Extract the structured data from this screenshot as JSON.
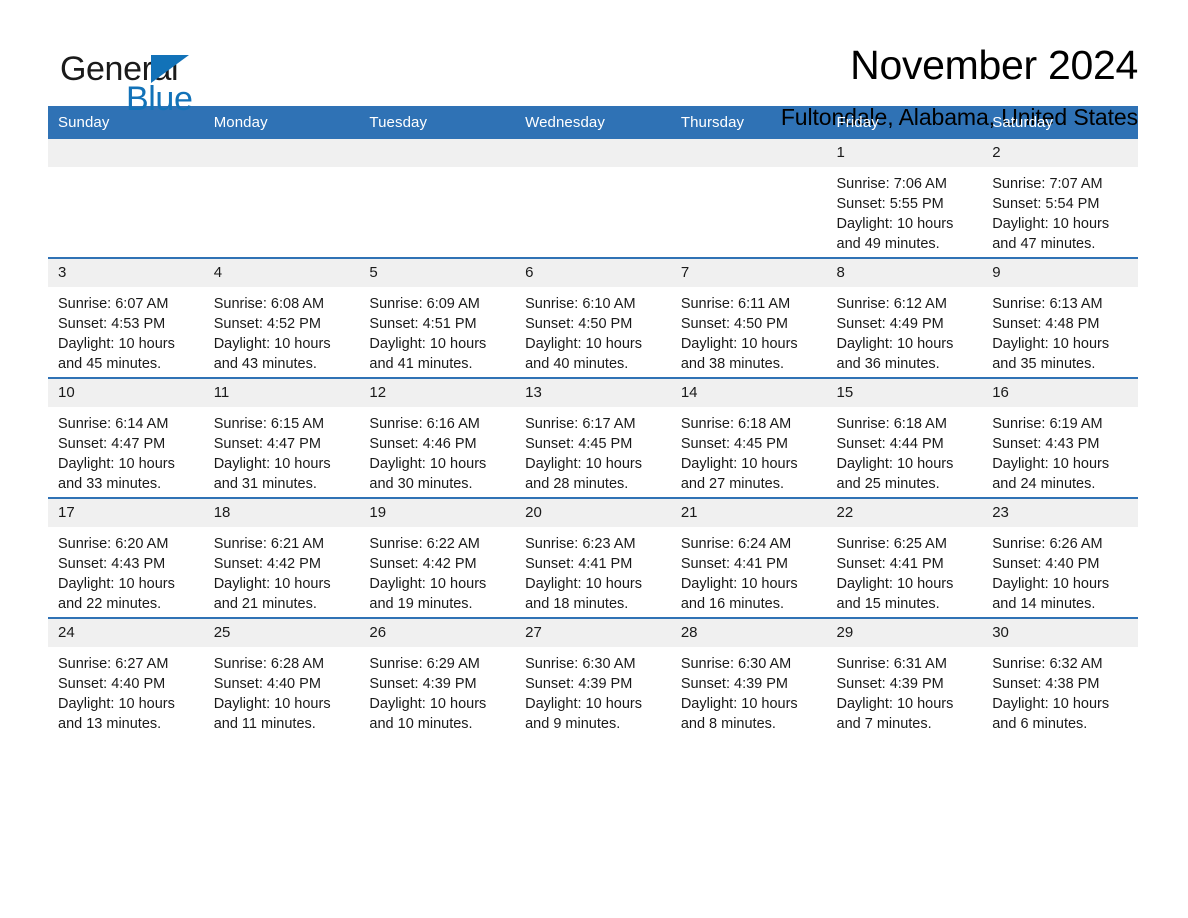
{
  "brand": {
    "name_part1": "General",
    "name_part2": "Blue",
    "accent_color": "#1272b8"
  },
  "header": {
    "title": "November 2024",
    "subtitle": "Fultondale, Alabama, United States"
  },
  "theme": {
    "header_blue": "#2f72b5",
    "daynum_gray": "#f0f0f0",
    "separator_blue": "#2f72b5"
  },
  "labels": {
    "sunrise_prefix": "Sunrise:",
    "sunset_prefix": "Sunset:",
    "daylight_prefix": "Daylight:"
  },
  "weekdays": [
    "Sunday",
    "Monday",
    "Tuesday",
    "Wednesday",
    "Thursday",
    "Friday",
    "Saturday"
  ],
  "weeks": [
    [
      {
        "day": "",
        "sunrise": "",
        "sunset": "",
        "daylight": "",
        "empty": true
      },
      {
        "day": "",
        "sunrise": "",
        "sunset": "",
        "daylight": "",
        "empty": true
      },
      {
        "day": "",
        "sunrise": "",
        "sunset": "",
        "daylight": "",
        "empty": true
      },
      {
        "day": "",
        "sunrise": "",
        "sunset": "",
        "daylight": "",
        "empty": true
      },
      {
        "day": "",
        "sunrise": "",
        "sunset": "",
        "daylight": "",
        "empty": true
      },
      {
        "day": "1",
        "sunrise": "Sunrise: 7:06 AM",
        "sunset": "Sunset: 5:55 PM",
        "daylight": "Daylight: 10 hours and 49 minutes.",
        "empty": false
      },
      {
        "day": "2",
        "sunrise": "Sunrise: 7:07 AM",
        "sunset": "Sunset: 5:54 PM",
        "daylight": "Daylight: 10 hours and 47 minutes.",
        "empty": false
      }
    ],
    [
      {
        "day": "3",
        "sunrise": "Sunrise: 6:07 AM",
        "sunset": "Sunset: 4:53 PM",
        "daylight": "Daylight: 10 hours and 45 minutes.",
        "empty": false
      },
      {
        "day": "4",
        "sunrise": "Sunrise: 6:08 AM",
        "sunset": "Sunset: 4:52 PM",
        "daylight": "Daylight: 10 hours and 43 minutes.",
        "empty": false
      },
      {
        "day": "5",
        "sunrise": "Sunrise: 6:09 AM",
        "sunset": "Sunset: 4:51 PM",
        "daylight": "Daylight: 10 hours and 41 minutes.",
        "empty": false
      },
      {
        "day": "6",
        "sunrise": "Sunrise: 6:10 AM",
        "sunset": "Sunset: 4:50 PM",
        "daylight": "Daylight: 10 hours and 40 minutes.",
        "empty": false
      },
      {
        "day": "7",
        "sunrise": "Sunrise: 6:11 AM",
        "sunset": "Sunset: 4:50 PM",
        "daylight": "Daylight: 10 hours and 38 minutes.",
        "empty": false
      },
      {
        "day": "8",
        "sunrise": "Sunrise: 6:12 AM",
        "sunset": "Sunset: 4:49 PM",
        "daylight": "Daylight: 10 hours and 36 minutes.",
        "empty": false
      },
      {
        "day": "9",
        "sunrise": "Sunrise: 6:13 AM",
        "sunset": "Sunset: 4:48 PM",
        "daylight": "Daylight: 10 hours and 35 minutes.",
        "empty": false
      }
    ],
    [
      {
        "day": "10",
        "sunrise": "Sunrise: 6:14 AM",
        "sunset": "Sunset: 4:47 PM",
        "daylight": "Daylight: 10 hours and 33 minutes.",
        "empty": false
      },
      {
        "day": "11",
        "sunrise": "Sunrise: 6:15 AM",
        "sunset": "Sunset: 4:47 PM",
        "daylight": "Daylight: 10 hours and 31 minutes.",
        "empty": false
      },
      {
        "day": "12",
        "sunrise": "Sunrise: 6:16 AM",
        "sunset": "Sunset: 4:46 PM",
        "daylight": "Daylight: 10 hours and 30 minutes.",
        "empty": false
      },
      {
        "day": "13",
        "sunrise": "Sunrise: 6:17 AM",
        "sunset": "Sunset: 4:45 PM",
        "daylight": "Daylight: 10 hours and 28 minutes.",
        "empty": false
      },
      {
        "day": "14",
        "sunrise": "Sunrise: 6:18 AM",
        "sunset": "Sunset: 4:45 PM",
        "daylight": "Daylight: 10 hours and 27 minutes.",
        "empty": false
      },
      {
        "day": "15",
        "sunrise": "Sunrise: 6:18 AM",
        "sunset": "Sunset: 4:44 PM",
        "daylight": "Daylight: 10 hours and 25 minutes.",
        "empty": false
      },
      {
        "day": "16",
        "sunrise": "Sunrise: 6:19 AM",
        "sunset": "Sunset: 4:43 PM",
        "daylight": "Daylight: 10 hours and 24 minutes.",
        "empty": false
      }
    ],
    [
      {
        "day": "17",
        "sunrise": "Sunrise: 6:20 AM",
        "sunset": "Sunset: 4:43 PM",
        "daylight": "Daylight: 10 hours and 22 minutes.",
        "empty": false
      },
      {
        "day": "18",
        "sunrise": "Sunrise: 6:21 AM",
        "sunset": "Sunset: 4:42 PM",
        "daylight": "Daylight: 10 hours and 21 minutes.",
        "empty": false
      },
      {
        "day": "19",
        "sunrise": "Sunrise: 6:22 AM",
        "sunset": "Sunset: 4:42 PM",
        "daylight": "Daylight: 10 hours and 19 minutes.",
        "empty": false
      },
      {
        "day": "20",
        "sunrise": "Sunrise: 6:23 AM",
        "sunset": "Sunset: 4:41 PM",
        "daylight": "Daylight: 10 hours and 18 minutes.",
        "empty": false
      },
      {
        "day": "21",
        "sunrise": "Sunrise: 6:24 AM",
        "sunset": "Sunset: 4:41 PM",
        "daylight": "Daylight: 10 hours and 16 minutes.",
        "empty": false
      },
      {
        "day": "22",
        "sunrise": "Sunrise: 6:25 AM",
        "sunset": "Sunset: 4:41 PM",
        "daylight": "Daylight: 10 hours and 15 minutes.",
        "empty": false
      },
      {
        "day": "23",
        "sunrise": "Sunrise: 6:26 AM",
        "sunset": "Sunset: 4:40 PM",
        "daylight": "Daylight: 10 hours and 14 minutes.",
        "empty": false
      }
    ],
    [
      {
        "day": "24",
        "sunrise": "Sunrise: 6:27 AM",
        "sunset": "Sunset: 4:40 PM",
        "daylight": "Daylight: 10 hours and 13 minutes.",
        "empty": false
      },
      {
        "day": "25",
        "sunrise": "Sunrise: 6:28 AM",
        "sunset": "Sunset: 4:40 PM",
        "daylight": "Daylight: 10 hours and 11 minutes.",
        "empty": false
      },
      {
        "day": "26",
        "sunrise": "Sunrise: 6:29 AM",
        "sunset": "Sunset: 4:39 PM",
        "daylight": "Daylight: 10 hours and 10 minutes.",
        "empty": false
      },
      {
        "day": "27",
        "sunrise": "Sunrise: 6:30 AM",
        "sunset": "Sunset: 4:39 PM",
        "daylight": "Daylight: 10 hours and 9 minutes.",
        "empty": false
      },
      {
        "day": "28",
        "sunrise": "Sunrise: 6:30 AM",
        "sunset": "Sunset: 4:39 PM",
        "daylight": "Daylight: 10 hours and 8 minutes.",
        "empty": false
      },
      {
        "day": "29",
        "sunrise": "Sunrise: 6:31 AM",
        "sunset": "Sunset: 4:39 PM",
        "daylight": "Daylight: 10 hours and 7 minutes.",
        "empty": false
      },
      {
        "day": "30",
        "sunrise": "Sunrise: 6:32 AM",
        "sunset": "Sunset: 4:38 PM",
        "daylight": "Daylight: 10 hours and 6 minutes.",
        "empty": false
      }
    ]
  ]
}
